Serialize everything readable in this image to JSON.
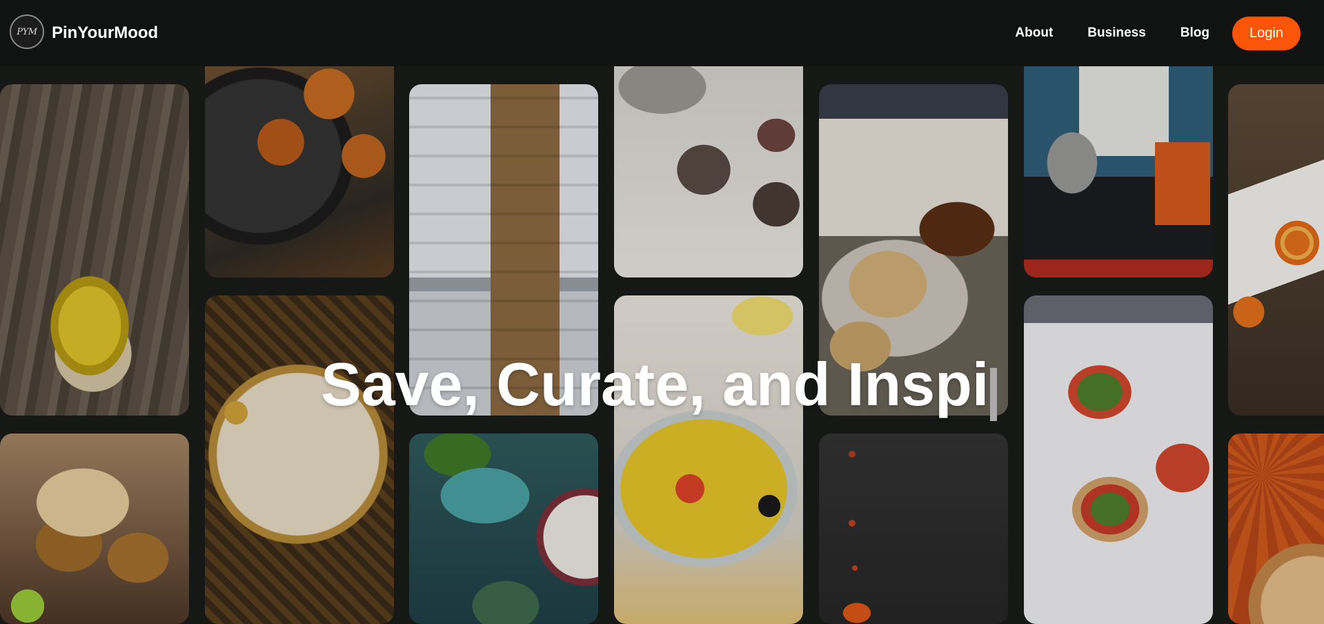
{
  "brand": {
    "logo_text": "PYM",
    "name": "PinYourMood"
  },
  "nav": {
    "links": [
      "About",
      "Business",
      "Blog"
    ],
    "login_label": "Login",
    "accent_color": "#fb5607"
  },
  "hero": {
    "headline": "Save, Curate, and Inspi"
  },
  "gallery": {
    "tiles": [
      {
        "icon": "lassi-photo"
      },
      {
        "icon": "fried-snack-photo"
      },
      {
        "icon": "cookie-stack-photo"
      },
      {
        "icon": "chai-pour-photo"
      },
      {
        "icon": "samosa-photo"
      },
      {
        "icon": "chai-stall-photo"
      },
      {
        "icon": "jalebi-photo"
      },
      {
        "icon": "kheer-photo"
      },
      {
        "icon": "pulao-photo"
      },
      {
        "icon": "vada-pav-photo"
      },
      {
        "icon": "salad-photo"
      },
      {
        "icon": "sauce-drip-photo"
      },
      {
        "icon": "chaat-photo"
      },
      {
        "icon": "sandwich-photo"
      }
    ]
  }
}
